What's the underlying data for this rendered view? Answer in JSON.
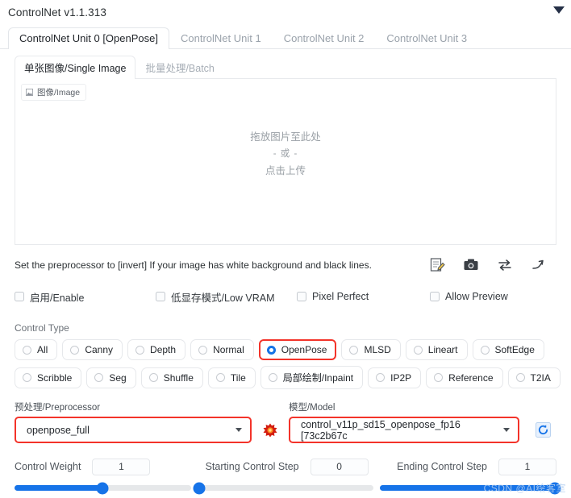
{
  "header": {
    "title": "ControlNet v1.1.313",
    "collapse_icon": "chevron-down-icon"
  },
  "unit_tabs": [
    {
      "label": "ControlNet Unit 0 [OpenPose]",
      "active": true
    },
    {
      "label": "ControlNet Unit 1",
      "active": false
    },
    {
      "label": "ControlNet Unit 2",
      "active": false
    },
    {
      "label": "ControlNet Unit 3",
      "active": false
    }
  ],
  "sub_tabs": [
    {
      "label": "单张图像/Single Image",
      "active": true
    },
    {
      "label": "批量处理/Batch",
      "active": false
    }
  ],
  "image_panel": {
    "chip_label": "图像/Image",
    "chip_icon": "image-icon",
    "drop_line1": "拖放图片至此处",
    "drop_line2": "- 或 -",
    "drop_line3": "点击上传"
  },
  "hint": {
    "text": "Set the preprocessor to [invert] If your image has white background and black lines.",
    "icons": [
      "edit-note-icon",
      "camera-icon",
      "swap-arrows-icon",
      "arrow-out-icon"
    ]
  },
  "checkboxes": [
    {
      "label": "启用/Enable",
      "checked": false
    },
    {
      "label": "低显存模式/Low VRAM",
      "checked": false
    },
    {
      "label": "Pixel Perfect",
      "checked": false
    },
    {
      "label": "Allow Preview",
      "checked": false
    }
  ],
  "control_type": {
    "label": "Control Type",
    "row1": [
      {
        "label": "All",
        "selected": false
      },
      {
        "label": "Canny",
        "selected": false
      },
      {
        "label": "Depth",
        "selected": false
      },
      {
        "label": "Normal",
        "selected": false
      },
      {
        "label": "OpenPose",
        "selected": true
      },
      {
        "label": "MLSD",
        "selected": false
      },
      {
        "label": "Lineart",
        "selected": false
      },
      {
        "label": "SoftEdge",
        "selected": false
      }
    ],
    "row2": [
      {
        "label": "Scribble",
        "selected": false
      },
      {
        "label": "Seg",
        "selected": false
      },
      {
        "label": "Shuffle",
        "selected": false
      },
      {
        "label": "Tile",
        "selected": false
      },
      {
        "label": "局部绘制/Inpaint",
        "selected": false
      },
      {
        "label": "IP2P",
        "selected": false
      },
      {
        "label": "Reference",
        "selected": false
      },
      {
        "label": "T2IA",
        "selected": false
      }
    ]
  },
  "preprocessor": {
    "label": "预处理/Preprocessor",
    "value": "openpose_full",
    "run_icon": "burst-icon"
  },
  "model": {
    "label": "模型/Model",
    "value": "control_v11p_sd15_openpose_fp16 [73c2b67c",
    "refresh_icon": "refresh-icon"
  },
  "sliders": [
    {
      "name": "Control Weight",
      "value": "1",
      "percent": 50
    },
    {
      "name": "Starting Control Step",
      "value": "0",
      "percent": 0
    },
    {
      "name": "Ending Control Step",
      "value": "1",
      "percent": 100
    }
  ],
  "watermark": "CSDN @AI绘客室",
  "colors": {
    "accent_blue": "#1673e8",
    "highlight_red": "#f3332a",
    "muted_text": "#9aa2ab"
  }
}
